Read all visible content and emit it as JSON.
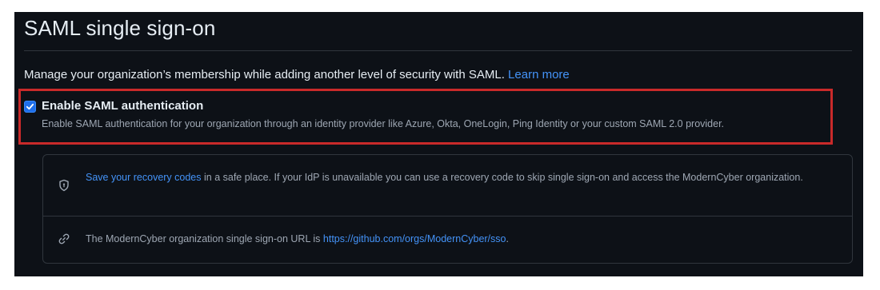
{
  "section": {
    "title": "SAML single sign-on",
    "description": "Manage your organization’s membership while adding another level of security with SAML.",
    "learn_more": "Learn more"
  },
  "saml_option": {
    "checked": true,
    "label": "Enable SAML authentication",
    "note": "Enable SAML authentication for your organization through an identity provider like Azure, Okta, OneLogin, Ping Identity or your custom SAML 2.0 provider."
  },
  "info": {
    "recovery": {
      "icon": "shield-icon",
      "link": "Save your recovery codes",
      "text": " in a safe place. If your IdP is unavailable you can use a recovery code to skip single sign-on and access the ModernCyber organization."
    },
    "sso_url": {
      "icon": "link-icon",
      "text": "The ModernCyber organization single sign-on URL is ",
      "url": "https://github.com/orgs/ModernCyber/sso",
      "suffix": "."
    }
  },
  "colors": {
    "background": "#0d1117",
    "accent": "#4493f8",
    "highlight_border": "#c92a2a",
    "checkbox": "#1f6feb"
  }
}
